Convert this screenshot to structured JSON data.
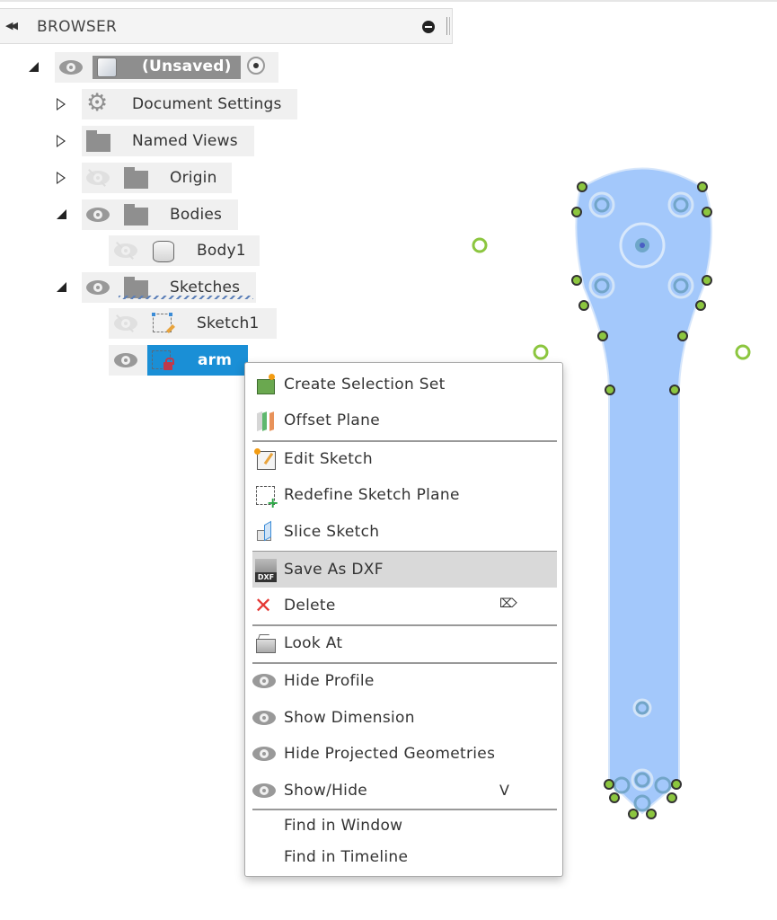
{
  "browser": {
    "title": "BROWSER",
    "collapse_icon": "double-left-arrow-icon",
    "pin_icon": "minus-circle-icon"
  },
  "tree": {
    "root": {
      "label": "(Unsaved)",
      "expanded": true,
      "visible": true,
      "active": true
    },
    "items": [
      {
        "label": "Document Settings",
        "icon": "gear-icon",
        "expanded": false
      },
      {
        "label": "Named Views",
        "icon": "folder-icon",
        "expanded": false
      },
      {
        "label": "Origin",
        "icon": "folder-icon",
        "expanded": false,
        "visible": false
      },
      {
        "label": "Bodies",
        "icon": "folder-icon",
        "expanded": true,
        "visible": true
      },
      {
        "label": "Body1",
        "icon": "body-icon",
        "visible": false
      },
      {
        "label": "Sketches",
        "icon": "folder-icon",
        "expanded": true,
        "visible": true
      },
      {
        "label": "Sketch1",
        "icon": "sketch-icon",
        "visible": false
      },
      {
        "label": "arm",
        "icon": "sketch-locked-icon",
        "visible": true,
        "selected": true
      }
    ]
  },
  "context_menu": {
    "items": [
      {
        "label": "Create Selection Set",
        "icon": "selection-set-icon"
      },
      {
        "label": "Offset Plane",
        "icon": "offset-plane-icon"
      },
      {
        "label": "Edit Sketch",
        "icon": "edit-sketch-icon"
      },
      {
        "label": "Redefine Sketch Plane",
        "icon": "redefine-plane-icon"
      },
      {
        "label": "Slice Sketch",
        "icon": "slice-icon"
      },
      {
        "label": "Save As DXF",
        "icon": "dxf-icon",
        "highlighted": true
      },
      {
        "label": "Delete",
        "icon": "delete-icon",
        "shortcut_icon": "delete-key-icon"
      },
      {
        "label": "Look At",
        "icon": "look-at-icon"
      },
      {
        "label": "Hide Profile",
        "icon": "eye-icon"
      },
      {
        "label": "Show Dimension",
        "icon": "eye-icon"
      },
      {
        "label": "Hide Projected Geometries",
        "icon": "eye-icon"
      },
      {
        "label": "Show/Hide",
        "icon": "eye-icon",
        "shortcut": "V"
      },
      {
        "label": "Find in Window"
      },
      {
        "label": "Find in Timeline"
      }
    ]
  },
  "colors": {
    "selection": "#1a8fd6",
    "sketch_fill": "#a3c8fb",
    "point_green": "#8cc63f",
    "menu_highlight": "#d9d9d9"
  }
}
